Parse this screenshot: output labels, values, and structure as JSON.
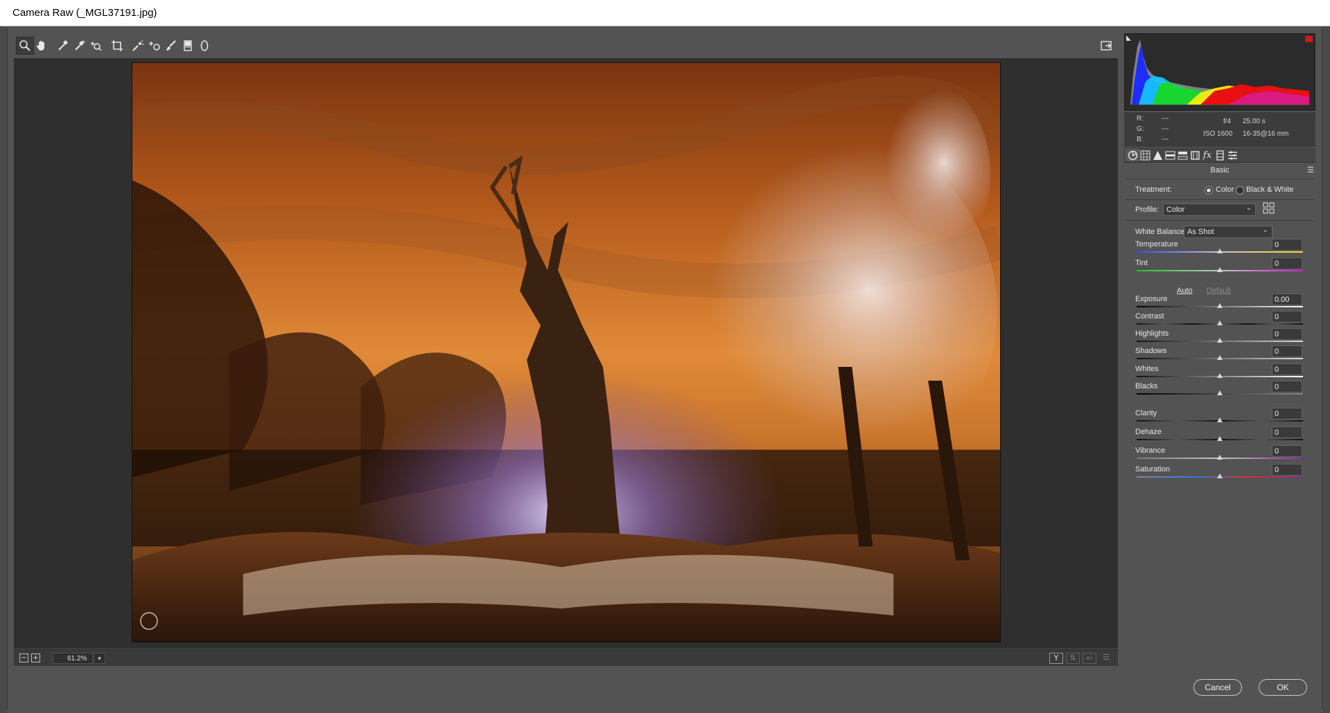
{
  "window": {
    "title": "Camera Raw (_MGL37191.jpg)"
  },
  "toolbar": {
    "tools": [
      {
        "icon": "zoom-icon"
      },
      {
        "icon": "hand-icon"
      },
      {
        "icon": "white-balance-eyedropper-icon"
      },
      {
        "icon": "color-sampler-icon"
      },
      {
        "icon": "targeted-adjustment-icon"
      },
      {
        "icon": "crop-icon"
      },
      {
        "icon": "spot-removal-icon"
      },
      {
        "icon": "red-eye-icon"
      },
      {
        "icon": "adjustment-brush-icon"
      },
      {
        "icon": "graduated-filter-icon"
      },
      {
        "icon": "radial-filter-icon"
      }
    ],
    "fullscreen_icon": "toggle-fullscreen-icon"
  },
  "preview": {
    "zoom": "61.2%"
  },
  "readout": {
    "r_label": "R:",
    "r_value": "---",
    "g_label": "G:",
    "g_value": "---",
    "b_label": "B:",
    "b_value": "---",
    "aperture": "f/4",
    "shutter": "25.00 s",
    "iso": "ISO 1600",
    "lens": "16-35@16 mm"
  },
  "panel": {
    "section": "Basic",
    "treatment": {
      "label": "Treatment:",
      "option_color": "Color",
      "option_bw": "Black & White",
      "selected": "Color"
    },
    "profile": {
      "label": "Profile:",
      "value": "Color"
    },
    "white_balance": {
      "label": "White Balance:",
      "value": "As Shot"
    },
    "auto_label": "Auto",
    "default_label": "Default",
    "sliders": [
      {
        "label": "Temperature",
        "value": "0"
      },
      {
        "label": "Tint",
        "value": "0"
      },
      {
        "label": "Exposure",
        "value": "0.00"
      },
      {
        "label": "Contrast",
        "value": "0"
      },
      {
        "label": "Highlights",
        "value": "0"
      },
      {
        "label": "Shadows",
        "value": "0"
      },
      {
        "label": "Whites",
        "value": "0"
      },
      {
        "label": "Blacks",
        "value": "0"
      },
      {
        "label": "Clarity",
        "value": "0"
      },
      {
        "label": "Dehaze",
        "value": "0"
      },
      {
        "label": "Vibrance",
        "value": "0"
      },
      {
        "label": "Saturation",
        "value": "0"
      }
    ]
  },
  "buttons": {
    "cancel": "Cancel",
    "ok": "OK"
  },
  "colors": {
    "accent_red": "#cc1a1a",
    "panel_bg": "#535353",
    "preview_bg": "#2f2f2f"
  }
}
